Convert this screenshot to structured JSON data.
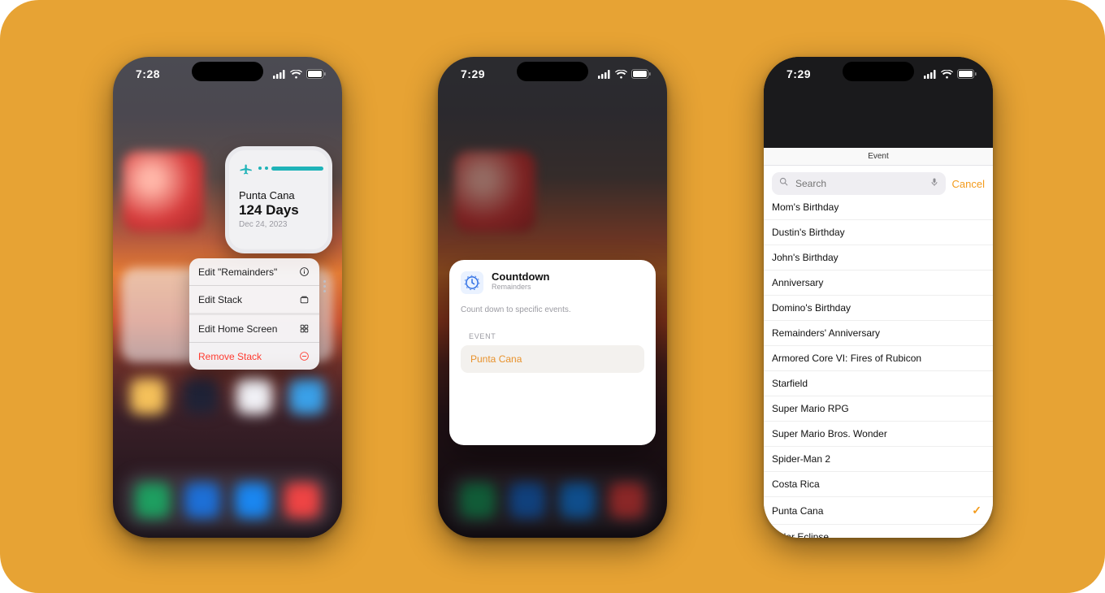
{
  "colors": {
    "accent_orange": "#f39b1c",
    "danger": "#ff3b30",
    "teal": "#1fb3b8"
  },
  "phone1": {
    "time": "7:28",
    "widget": {
      "destination": "Punta Cana",
      "countdown": "124 Days",
      "date": "Dec 24, 2023"
    },
    "menu": {
      "edit_app": "Edit \"Remainders\"",
      "edit_stack": "Edit Stack",
      "edit_home": "Edit Home Screen",
      "remove": "Remove Stack"
    }
  },
  "phone2": {
    "time": "7:29",
    "sheet": {
      "title": "Countdown",
      "subtitle": "Remainders",
      "description": "Count down to specific events.",
      "field_label": "EVENT",
      "selected_event": "Punta Cana"
    }
  },
  "phone3": {
    "time": "7:29",
    "header": {
      "title": "Event",
      "search_placeholder": "Search",
      "cancel": "Cancel"
    },
    "selected": "Punta Cana",
    "events": [
      "Mom's Birthday",
      "Dustin's Birthday",
      "John's Birthday",
      "Anniversary",
      "Domino's Birthday",
      "Remainders' Anniversary",
      "Armored Core VI: Fires of Rubicon",
      "Starfield",
      "Super Mario RPG",
      "Super Mario Bros. Wonder",
      "Spider-Man 2",
      "Costa Rica",
      "Punta Cana",
      "Solar Eclipse"
    ]
  }
}
